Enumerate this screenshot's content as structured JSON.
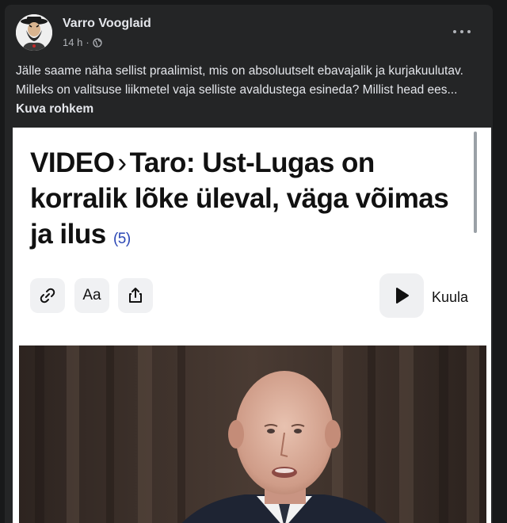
{
  "post": {
    "author": "Varro Vooglaid",
    "time": "14 h",
    "separator": "·",
    "privacy_icon": "globe-icon",
    "more_icon": "more-horiz-icon",
    "caption": "Jälle saame näha sellist praalimist, mis on absoluutselt ebavajalik ja kurjakuulutav. Milleks on valitsuse liikmetel vaja selliste avaldustega esineda? Millist head ees...",
    "see_more": "Kuva rohkem"
  },
  "article": {
    "kicker": "VIDEO",
    "chevron": "›",
    "title": "Taro: Ust-Lugas on korralik lõke üleval, väga võimas ja ilus",
    "comment_count": "(5)",
    "tools": {
      "link_icon": "link-icon",
      "text_size_label": "Aa",
      "share_icon": "share-icon"
    },
    "play_icon": "play-icon",
    "listen_label": "Kuula"
  },
  "colors": {
    "page_bg": "#18191a",
    "card_bg": "#242526",
    "text_primary": "#e4e6eb",
    "text_secondary": "#b0b3b8",
    "count_blue": "#2b47b5"
  }
}
